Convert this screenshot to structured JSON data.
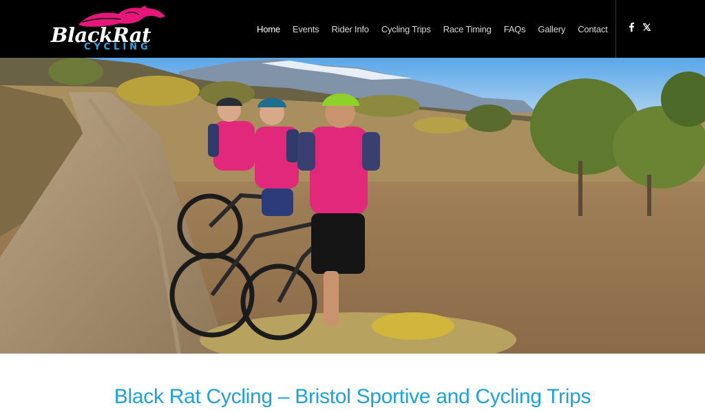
{
  "brand": {
    "name": "BlackRat",
    "tagline": "CYCLING",
    "rat_color": "#e5177b",
    "tagline_color": "#2ba9e6"
  },
  "nav": {
    "items": [
      {
        "label": "Home",
        "active": true
      },
      {
        "label": "Events"
      },
      {
        "label": "Rider Info"
      },
      {
        "label": "Cycling Trips"
      },
      {
        "label": "Race Timing"
      },
      {
        "label": "FAQs"
      },
      {
        "label": "Gallery"
      },
      {
        "label": "Contact"
      }
    ]
  },
  "social": {
    "facebook": "f",
    "x": "𝕏"
  },
  "hero": {
    "image": "three cyclists with mountain bikes on a dirt track in dry countryside"
  },
  "page": {
    "heading": "Black Rat Cycling – Bristol Sportive and Cycling Trips",
    "heading_color": "#1ba1de"
  }
}
